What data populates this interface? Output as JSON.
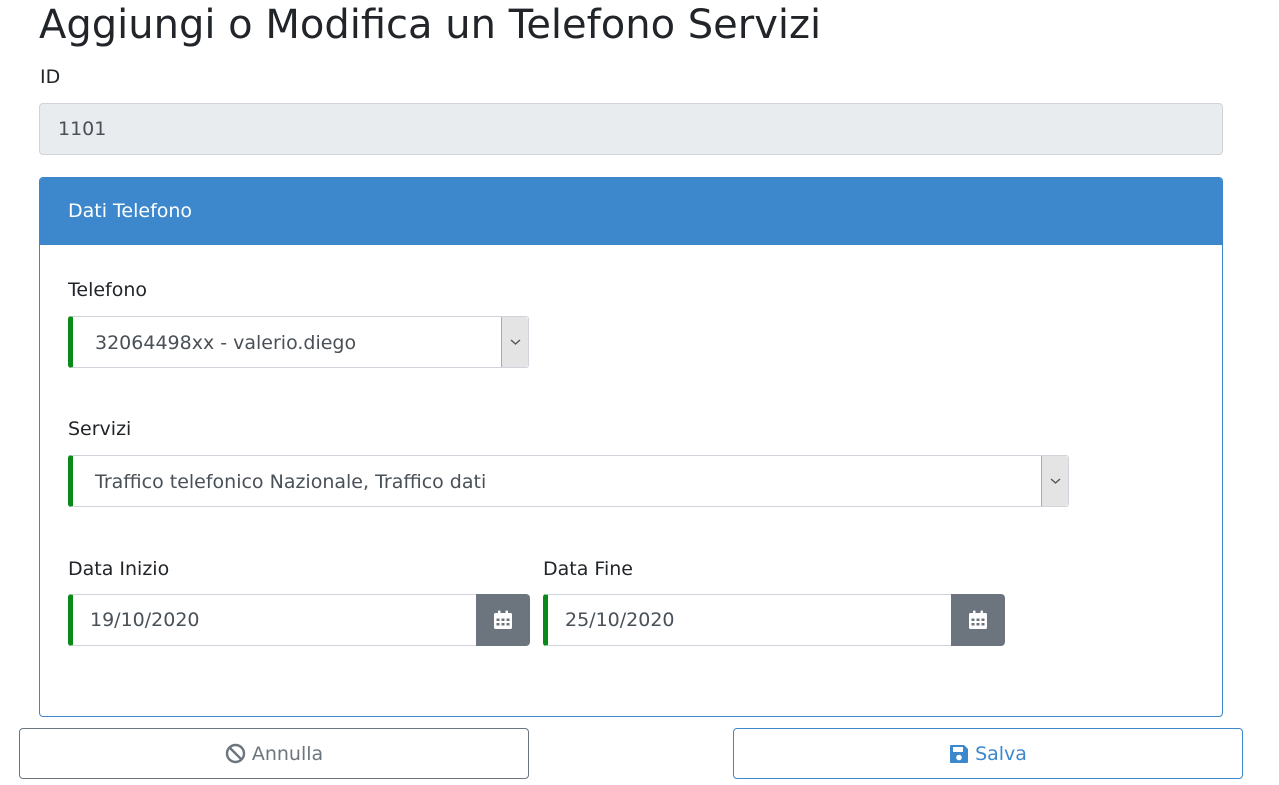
{
  "page": {
    "title": "Aggiungi o Modifica un Telefono Servizi"
  },
  "id_field": {
    "label": "ID",
    "value": "1101"
  },
  "panel": {
    "title": "Dati Telefono",
    "telefono": {
      "label": "Telefono",
      "selected": "32064498xx - valerio.diego"
    },
    "servizi": {
      "label": "Servizi",
      "selected": "Traffico telefonico Nazionale, Traffico dati"
    },
    "data_inizio": {
      "label": "Data Inizio",
      "value": "19/10/2020"
    },
    "data_fine": {
      "label": "Data Fine",
      "value": "25/10/2020"
    }
  },
  "actions": {
    "cancel_label": "Annulla",
    "save_label": "Salva"
  },
  "icons": {
    "dropdown": "chevron-down-icon",
    "date_picker": "calendar-icon",
    "cancel": "ban-icon",
    "save": "floppy-disk-icon"
  },
  "colors": {
    "primary": "#3d88cd",
    "valid_border": "#0a8a18",
    "secondary": "#6c757d",
    "disabled_bg": "#e9ecef"
  }
}
